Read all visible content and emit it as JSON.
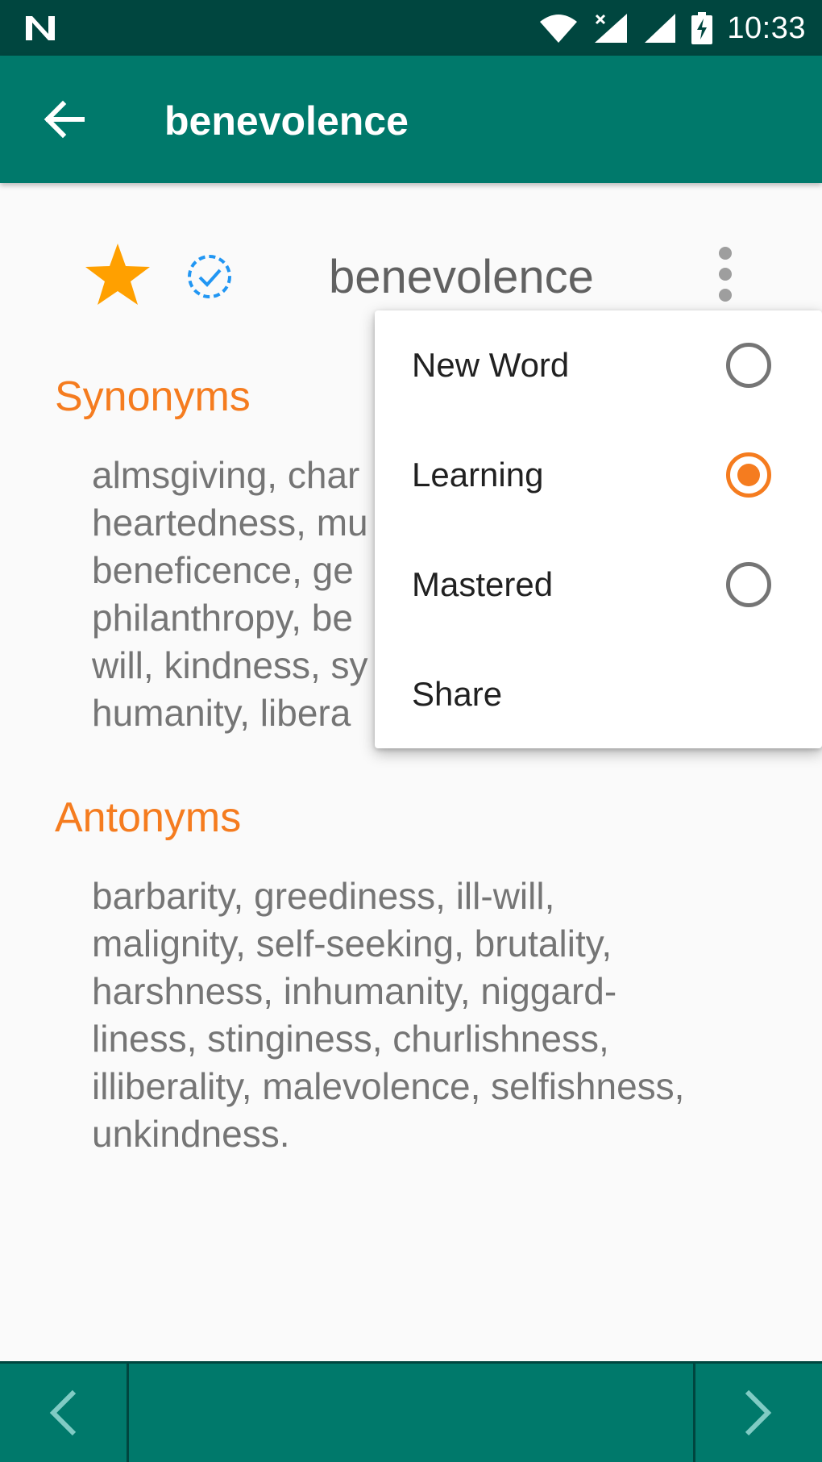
{
  "status_bar": {
    "time": "10:33",
    "icons": [
      "n-logo-icon",
      "wifi-icon",
      "signal-x-icon",
      "signal-icon",
      "battery-charging-icon"
    ]
  },
  "app_bar": {
    "title": "benevolence",
    "back_icon": "arrow-back-icon"
  },
  "word": {
    "text": "benevolence",
    "starred": true,
    "star_color": "#ffa000",
    "check_color": "#2196f3"
  },
  "synonyms": {
    "title": "Synonyms",
    "lines": [
      "almsgiving, char",
      "heartedness, mu",
      "beneficence, ge",
      "philanthropy, be",
      "will, kindness, sy",
      "humanity, libera"
    ]
  },
  "antonyms": {
    "title": "Antonyms",
    "lines": [
      "barbarity, greediness, ill-will,",
      "malignity, self-seeking, brutality,",
      "harshness, inhumanity, niggard-",
      "liness, stinginess, churlishness,",
      "illiberality, malevolence, selfishness,",
      "unkindness."
    ]
  },
  "menu": {
    "items": [
      {
        "label": "New Word",
        "selected": false
      },
      {
        "label": "Learning",
        "selected": true
      },
      {
        "label": "Mastered",
        "selected": false
      },
      {
        "label": "Share"
      }
    ]
  },
  "colors": {
    "primary": "#00796b",
    "primary_dark": "#00463f",
    "accent": "#f57c1f",
    "body_text": "#757575"
  },
  "bottom_nav": {
    "prev_icon": "chevron-left-icon",
    "next_icon": "chevron-right-icon"
  }
}
